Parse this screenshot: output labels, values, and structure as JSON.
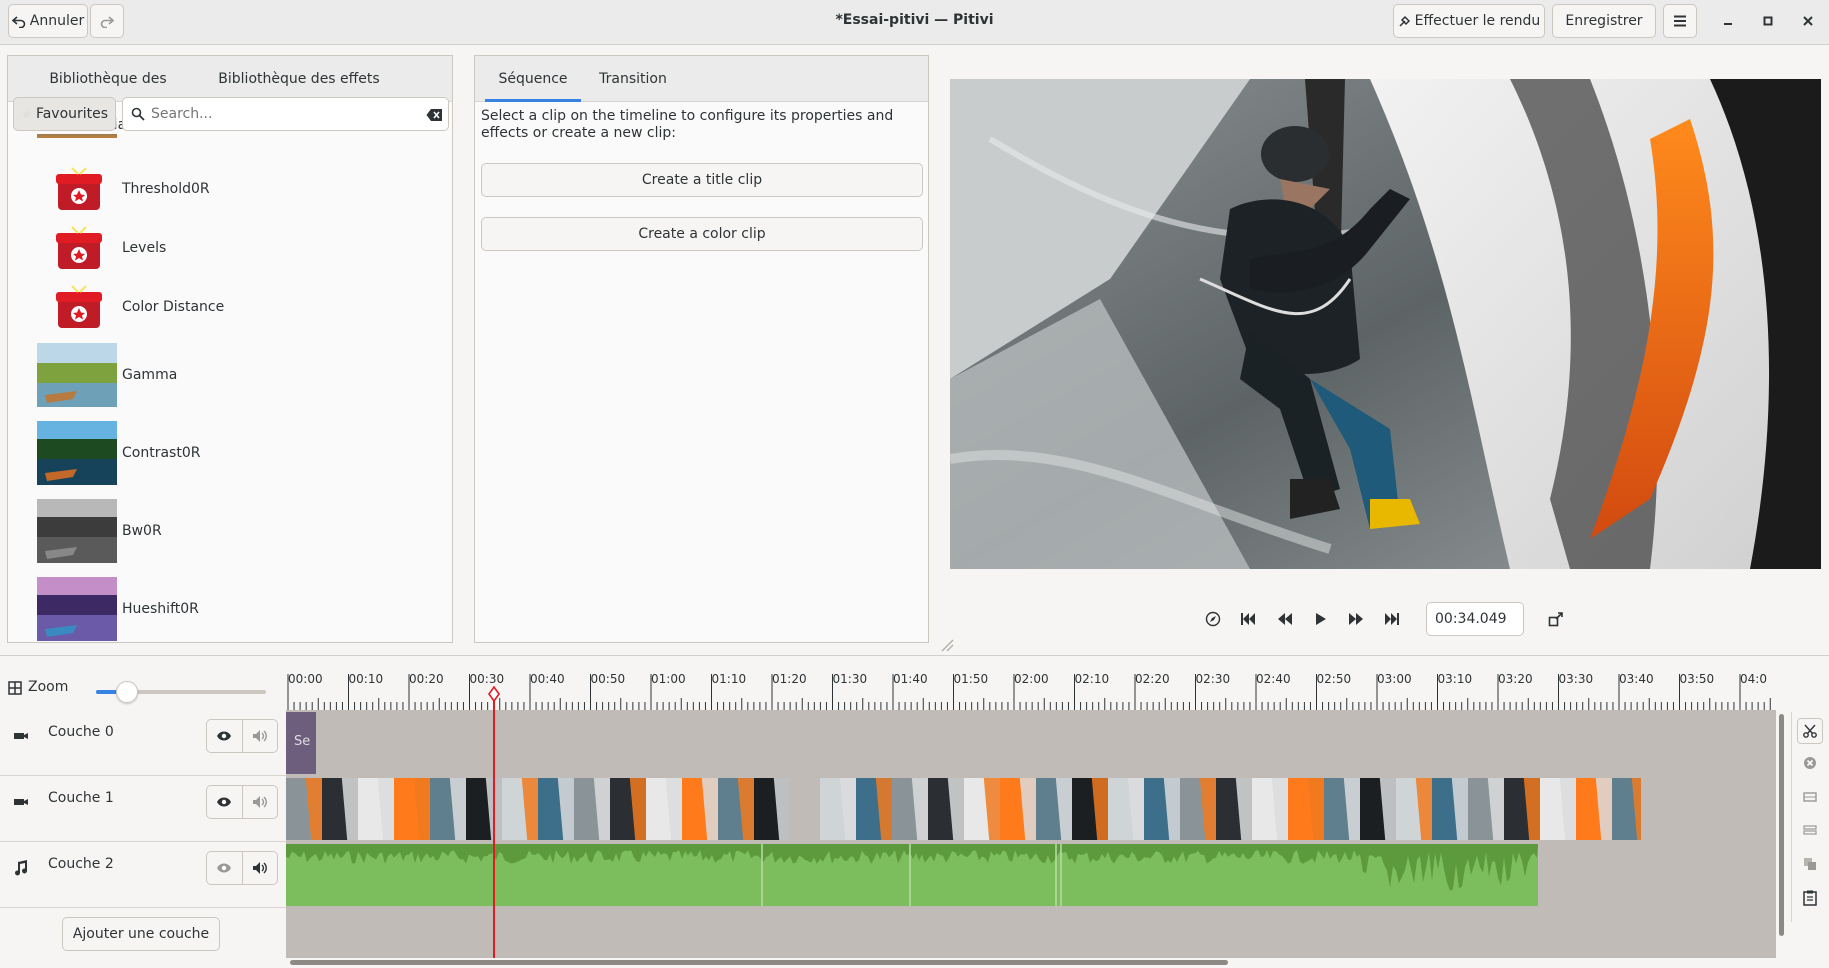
{
  "window": {
    "title": "*Essai-pitivi — Pitivi",
    "undo_label": "Annuler",
    "render_label": "Effectuer le rendu",
    "save_label": "Enregistrer"
  },
  "library": {
    "tabs": [
      "Bibliothèque des médias",
      "Bibliothèque des effets"
    ],
    "active_tab": 1,
    "favourites_label": "Favourites",
    "search_placeholder": "Search...",
    "effects": [
      {
        "name": "Threshold0R",
        "icon": "gift-icon"
      },
      {
        "name": "Levels",
        "icon": "gift-icon"
      },
      {
        "name": "Color Distance",
        "icon": "gift-icon"
      },
      {
        "name": "Gamma",
        "icon": "landscape-thumb"
      },
      {
        "name": "Contrast0R",
        "icon": "landscape-thumb"
      },
      {
        "name": "Bw0R",
        "icon": "landscape-thumb"
      },
      {
        "name": "Hueshift0R",
        "icon": "landscape-thumb"
      }
    ]
  },
  "properties": {
    "tabs": [
      "Séquence",
      "Transition"
    ],
    "active_tab": 0,
    "hint": "Select a clip on the timeline to configure its properties and effects or create a new clip:",
    "create_title_clip": "Create a title clip",
    "create_color_clip": "Create a color clip"
  },
  "viewer": {
    "timecode": "00:34.049"
  },
  "timeline": {
    "zoom_label": "Zoom",
    "zoom_level": 0.12,
    "playhead_time": "00:34.049",
    "ruler": [
      "00:00",
      "00:10",
      "00:20",
      "00:30",
      "00:40",
      "00:50",
      "01:00",
      "01:10",
      "01:20",
      "01:30",
      "01:40",
      "01:50",
      "02:00",
      "02:10",
      "02:20",
      "02:30",
      "02:40",
      "02:50",
      "03:00",
      "03:10",
      "03:20",
      "03:30",
      "03:40",
      "03:50",
      "04:0"
    ],
    "layers": [
      {
        "name": "Couche 0",
        "type": "video",
        "clip_label": "Se"
      },
      {
        "name": "Couche 1",
        "type": "video"
      },
      {
        "name": "Couche 2",
        "type": "audio"
      }
    ],
    "add_layer_label": "Ajouter une couche"
  },
  "colors": {
    "accent": "#3584e4",
    "playhead": "#e01b24",
    "audio_wave": "#5d9a3e",
    "audio_bg": "#7cbd5d",
    "title_clip": "#6e5e7e"
  }
}
